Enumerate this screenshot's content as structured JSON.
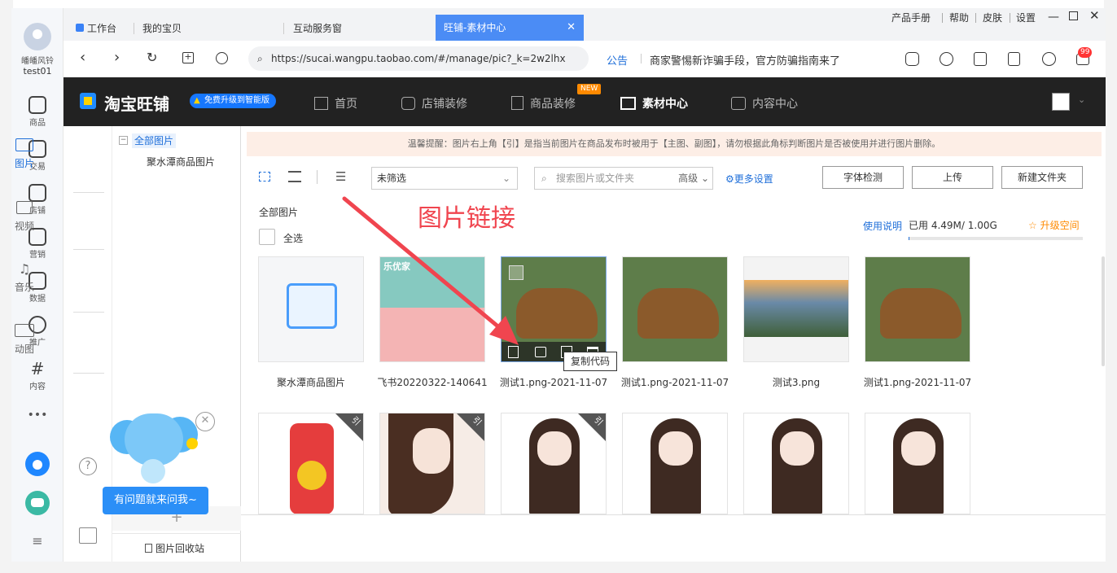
{
  "left_rail": {
    "user_name": "皤皤风铃",
    "user_sub": "test01",
    "items": [
      {
        "label": "商品",
        "icon": "product-icon"
      },
      {
        "label": "交易",
        "icon": "trade-icon"
      },
      {
        "label": "店铺",
        "icon": "store-icon"
      },
      {
        "label": "营销",
        "icon": "megaphone-icon"
      },
      {
        "label": "数据",
        "icon": "chart-icon"
      },
      {
        "label": "推广",
        "icon": "bulb-icon"
      },
      {
        "label": "内容",
        "icon": "hash-icon"
      }
    ],
    "more": "•••"
  },
  "tabs": [
    {
      "label": "工作台"
    },
    {
      "label": "我的宝贝"
    },
    {
      "label": "互动服务窗"
    },
    {
      "label": "旺铺-素材中心",
      "active": true
    }
  ],
  "top_links": [
    "产品手册",
    "帮助",
    "皮肤",
    "设置"
  ],
  "address": {
    "url": "https://sucai.wangpu.taobao.com/#/manage/pic?_k=2w2lhx",
    "announcement_label": "公告",
    "announcement_text": "商家警惕新诈骗手段，官方防骗指南来了",
    "badge": "99"
  },
  "header": {
    "logo": "淘宝旺铺",
    "upgrade_pill": "免费升级到智能版",
    "nav": [
      {
        "label": "首页"
      },
      {
        "label": "店铺装修"
      },
      {
        "label": "商品装修",
        "badge": "NEW"
      },
      {
        "label": "素材中心",
        "active": true
      },
      {
        "label": "内容中心"
      }
    ]
  },
  "subnav": [
    {
      "label": "图片",
      "active": true
    },
    {
      "label": "视频"
    },
    {
      "label": "音乐"
    },
    {
      "label": "动图"
    }
  ],
  "tree": {
    "root": "全部图片",
    "child": "聚水潭商品图片",
    "add": "+",
    "recycle": "图片回收站"
  },
  "notice": "温馨提醒：图片右上角【引】是指当前图片在商品发布时被用于【主图、副图】，请勿根据此角标判断图片是否被使用并进行图片删除。",
  "toolbar": {
    "filter_value": "未筛选",
    "search_placeholder": "搜索图片或文件夹",
    "advanced": "高级",
    "more_settings": "更多设置",
    "font_check": "字体检测",
    "upload": "上传",
    "new_folder": "新建文件夹"
  },
  "overlay_title": "图片链接",
  "content": {
    "breadcrumb": "全部图片",
    "select_all": "全选",
    "usage_help": "使用说明",
    "usage": "已用 4.49M/ 1.00G",
    "upgrade": "升级空间",
    "tooltip": "复制代码",
    "items_row1": [
      {
        "caption": "聚水潭商品图片",
        "kind": "folder"
      },
      {
        "caption": "飞书20220322-140641",
        "kind": "bedding"
      },
      {
        "caption": "测试1.png-2021-11-07",
        "kind": "bear"
      },
      {
        "caption": "测试1.png-2021-11-07",
        "kind": "bear"
      },
      {
        "caption": "测试3.png",
        "kind": "city"
      },
      {
        "caption": "测试1.png-2021-11-07",
        "kind": "bear"
      }
    ],
    "items_row2_badge": "引"
  },
  "helper": {
    "bubble": "有问题就来问我~"
  }
}
